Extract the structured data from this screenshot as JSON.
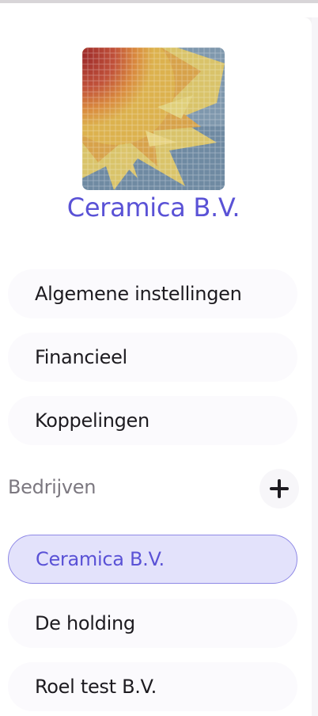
{
  "company": {
    "name": "Ceramica B.V.",
    "logo_icon": "mosaic-sun-logo"
  },
  "settings_menu": [
    {
      "label": "Algemene instellingen"
    },
    {
      "label": "Financieel"
    },
    {
      "label": "Koppelingen"
    }
  ],
  "companies_section": {
    "label": "Bedrijven",
    "add_icon": "plus-icon",
    "items": [
      {
        "label": "Ceramica B.V.",
        "active": true
      },
      {
        "label": "De holding",
        "active": false
      },
      {
        "label": "Roel test B.V.",
        "active": false
      }
    ]
  },
  "colors": {
    "accent": "#5a52d6",
    "active_bg": "#e3e2fb",
    "active_border": "#8f89e6",
    "text": "#1d1b20",
    "muted": "#7c7880"
  }
}
